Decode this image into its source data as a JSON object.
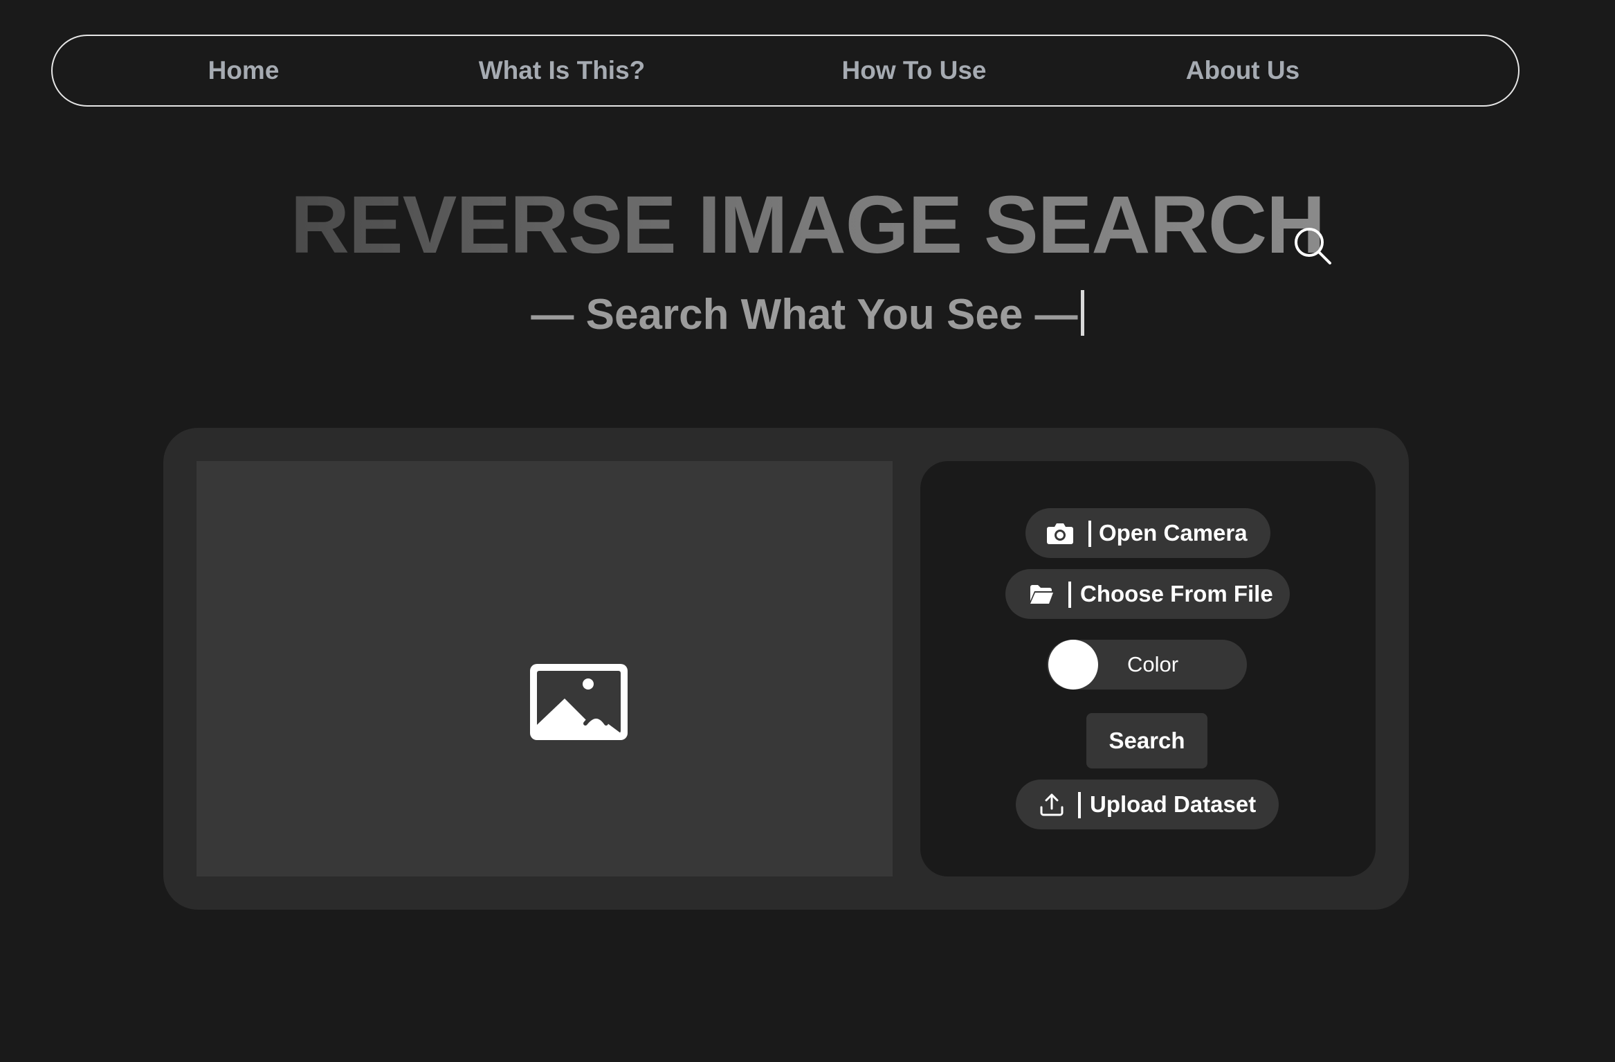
{
  "nav": {
    "items": [
      {
        "label": "Home"
      },
      {
        "label": "What Is This?"
      },
      {
        "label": "How To Use"
      },
      {
        "label": "About Us"
      }
    ]
  },
  "hero": {
    "title": "REVERSE IMAGE SEARCH",
    "title_icon": "search-icon",
    "subtitle": "— Search What You See —"
  },
  "preview": {
    "icon": "image-placeholder-icon"
  },
  "controls": {
    "open_camera": {
      "icon": "camera-icon",
      "label": "Open Camera"
    },
    "choose_file": {
      "icon": "folder-icon",
      "label": "Choose From File"
    },
    "color_toggle": {
      "label": "Color",
      "state": "off"
    },
    "search": {
      "label": "Search"
    },
    "upload_dataset": {
      "icon": "upload-icon",
      "label": "Upload Dataset"
    }
  },
  "colors": {
    "background": "#1a1a1a",
    "card": "#2b2b2b",
    "preview": "#383838",
    "button": "#363636",
    "nav_text": "#a6abb2"
  }
}
